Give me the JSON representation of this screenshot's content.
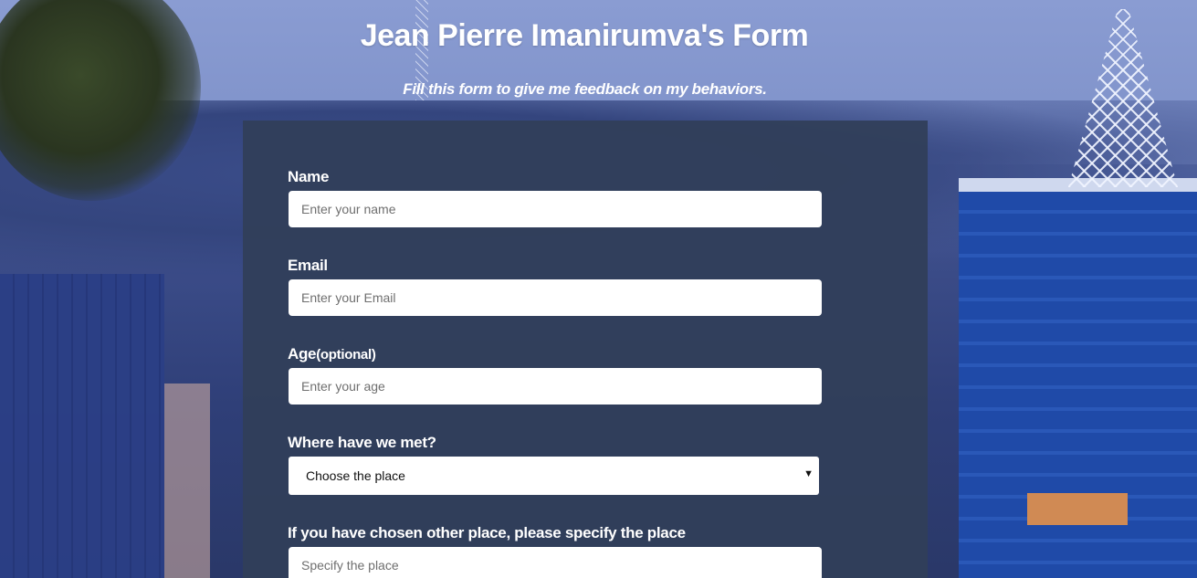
{
  "page": {
    "title": "Jean Pierre Imanirumva's Form",
    "subtitle": "Fill this form to give me feedback on my behaviors."
  },
  "form": {
    "name": {
      "label": "Name",
      "placeholder": "Enter your name",
      "value": ""
    },
    "email": {
      "label": "Email",
      "placeholder": "Enter your Email",
      "value": ""
    },
    "age": {
      "label": "Age",
      "label_suffix": "(optional)",
      "placeholder": "Enter your age",
      "value": ""
    },
    "place": {
      "label": "Where have we met?",
      "selected": "Choose the place"
    },
    "other_place": {
      "label": "If you have chosen other place, please specify the place",
      "placeholder": "Specify the place",
      "value": ""
    }
  },
  "colors": {
    "panel_bg": "#313f59",
    "text": "#ffffff",
    "input_bg": "#ffffff"
  },
  "icons": {
    "select_arrow": "triangle-down-icon"
  }
}
